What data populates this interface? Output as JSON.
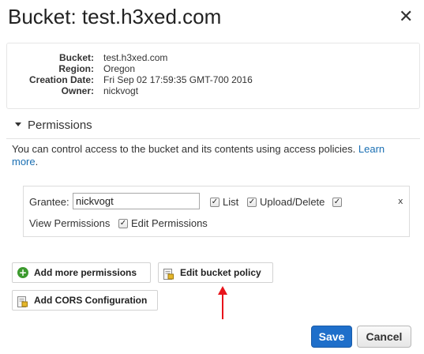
{
  "dialog": {
    "title": "Bucket: test.h3xed.com",
    "close_glyph": "✕"
  },
  "details": [
    {
      "key": "Bucket:",
      "value": "test.h3xed.com"
    },
    {
      "key": "Region:",
      "value": "Oregon"
    },
    {
      "key": "Creation Date:",
      "value": "Fri Sep 02 17:59:35 GMT-700 2016"
    },
    {
      "key": "Owner:",
      "value": "nickvogt"
    }
  ],
  "permissions": {
    "header": "Permissions",
    "intro_text": "You can control access to the bucket and its contents using access policies.",
    "learn_more": "Learn more",
    "grantee": {
      "label": "Grantee:",
      "value": "nickvogt",
      "list": {
        "label": "List",
        "checked": true
      },
      "upload_delete": {
        "label": "Upload/Delete",
        "checked": true
      },
      "view_permissions": {
        "label": "View Permissions",
        "checked": true
      },
      "edit_permissions": {
        "label": "Edit Permissions",
        "checked": true
      },
      "remove_glyph": "x"
    }
  },
  "buttons": {
    "add_more_permissions": "Add more permissions",
    "edit_bucket_policy": "Edit bucket policy",
    "add_cors": "Add CORS Configuration",
    "save": "Save",
    "cancel": "Cancel"
  },
  "colors": {
    "save_button": "#1f6fca",
    "link": "#1a6fb3",
    "add_icon": "#3c9a2e",
    "annotation_arrow": "#e8141b"
  },
  "icons": {
    "close": "close-icon",
    "caret": "caret-down-icon",
    "add": "add-circle-icon",
    "policy": "policy-document-icon",
    "cors": "cors-document-icon"
  }
}
